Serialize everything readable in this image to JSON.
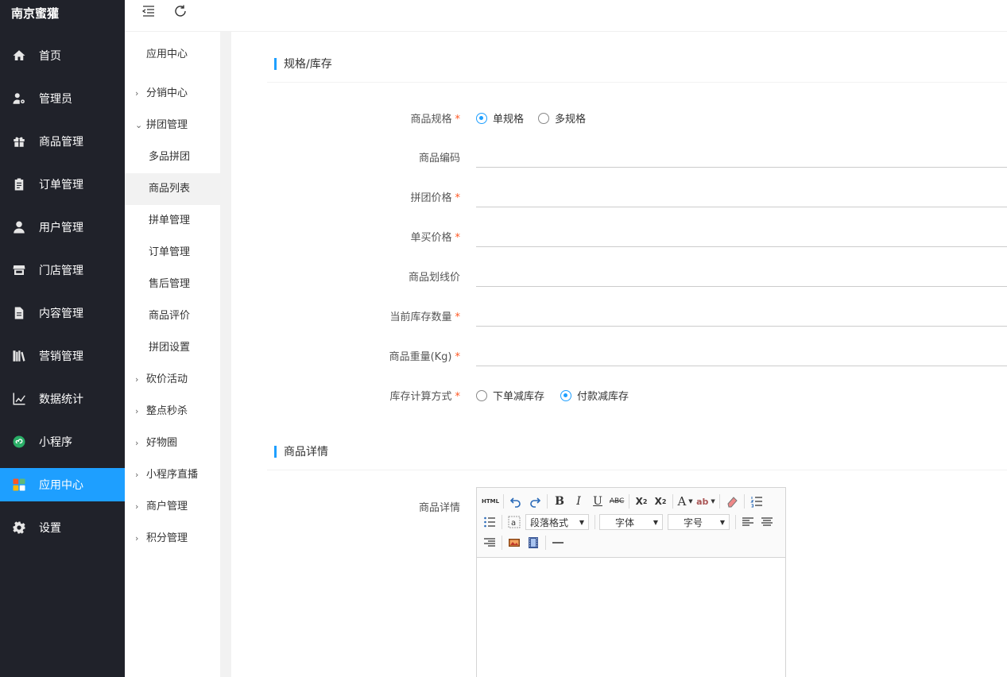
{
  "brand": "南京蜜獾",
  "nav": [
    {
      "label": "首页",
      "icon": "home-icon"
    },
    {
      "label": "管理员",
      "icon": "admin-icon"
    },
    {
      "label": "商品管理",
      "icon": "gift-icon"
    },
    {
      "label": "订单管理",
      "icon": "clipboard-icon"
    },
    {
      "label": "用户管理",
      "icon": "user-icon"
    },
    {
      "label": "门店管理",
      "icon": "store-icon"
    },
    {
      "label": "内容管理",
      "icon": "document-icon"
    },
    {
      "label": "营销管理",
      "icon": "books-icon"
    },
    {
      "label": "数据统计",
      "icon": "line-chart-icon"
    },
    {
      "label": "小程序",
      "icon": "miniprogram-icon"
    },
    {
      "label": "应用中心",
      "icon": "apps-icon",
      "active": true
    },
    {
      "label": "设置",
      "icon": "gear-icon"
    }
  ],
  "topbar": {
    "collapse_icon": "menu-fold-icon",
    "refresh_icon": "refresh-icon"
  },
  "submenu": {
    "title": "应用中心",
    "items": [
      {
        "label": "分销中心",
        "expanded": false
      },
      {
        "label": "拼团管理",
        "expanded": true,
        "children": [
          {
            "label": "多品拼团"
          },
          {
            "label": "商品列表",
            "active": true
          },
          {
            "label": "拼单管理"
          },
          {
            "label": "订单管理"
          },
          {
            "label": "售后管理"
          },
          {
            "label": "商品评价"
          },
          {
            "label": "拼团设置"
          }
        ]
      },
      {
        "label": "砍价活动",
        "expanded": false
      },
      {
        "label": "整点秒杀",
        "expanded": false
      },
      {
        "label": "好物圈",
        "expanded": false
      },
      {
        "label": "小程序直播",
        "expanded": false
      },
      {
        "label": "商户管理",
        "expanded": false
      },
      {
        "label": "积分管理",
        "expanded": false
      }
    ]
  },
  "form": {
    "section1": "规格/库存",
    "spec_label": "商品规格",
    "spec_options": [
      "单规格",
      "多规格"
    ],
    "spec_selected": "单规格",
    "code_label": "商品编码",
    "group_price_label": "拼团价格",
    "single_price_label": "单买价格",
    "line_price_label": "商品划线价",
    "stock_label": "当前库存数量",
    "weight_label": "商品重量(Kg)",
    "stock_calc_label": "库存计算方式",
    "stock_calc_options": [
      "下单减库存",
      "付款减库存"
    ],
    "stock_calc_selected": "付款减库存",
    "section2": "商品详情",
    "detail_label": "商品详情",
    "required_mark": "*"
  },
  "editor": {
    "html_btn": "HTML",
    "paragraph": "段落格式",
    "font": "字体",
    "size": "字号"
  },
  "colors": {
    "accent": "#1e9fff",
    "sidebar_bg": "#20222a",
    "required": "#ff5722"
  }
}
